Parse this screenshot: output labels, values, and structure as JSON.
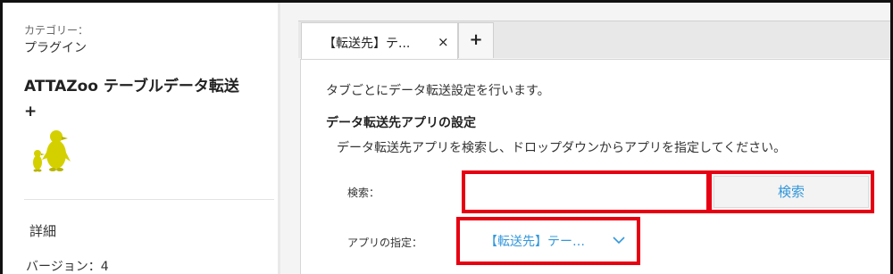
{
  "sidebar": {
    "category_label": "カテゴリー：",
    "category_value": "プラグイン",
    "plugin_title_line1": "ATTAZoo テーブルデータ転送",
    "plugin_title_line2": "+",
    "detail_label": "詳細",
    "version_text": "バージョン：4"
  },
  "tabs": {
    "active_tab_label": "【転送先】テ...",
    "close_symbol": "×",
    "add_symbol": "+"
  },
  "panel": {
    "description": "タブごとにデータ転送設定を行います。",
    "section_title": "データ転送先アプリの設定",
    "section_description": "データ転送先アプリを検索し、ドロップダウンからアプリを指定してください。",
    "search_label": "検索：",
    "search_value": "",
    "search_button": "検索",
    "app_label": "アプリの指定：",
    "app_select_value": "【転送先】テー…"
  },
  "colors": {
    "highlight": "#e60012",
    "link_blue": "#3498db",
    "mascot_yellow": "#d4d000"
  },
  "icons": {
    "mascot": "penguin-mascot-icon",
    "chevron": "chevron-down-icon",
    "close": "close-icon",
    "add": "plus-icon"
  }
}
